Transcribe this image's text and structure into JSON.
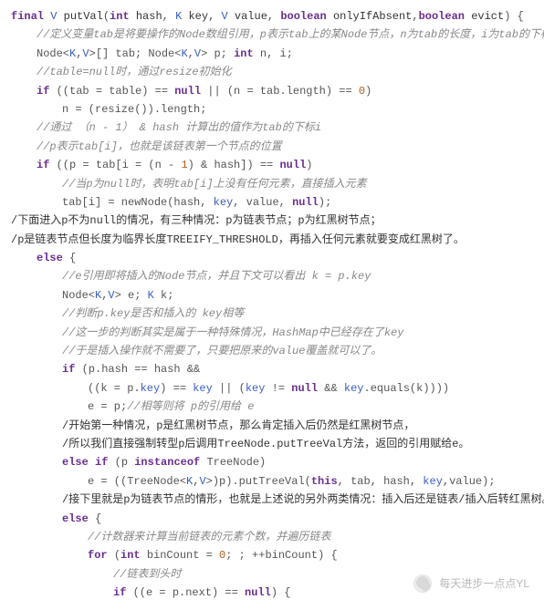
{
  "sig": {
    "final": "final",
    "retT": "V",
    "name": "putVal",
    "int": "int",
    "p1": "hash",
    "K": "K",
    "p2": "key",
    "V": "V",
    "p3": "value",
    "bool": "boolean",
    "p4": "onlyIfAbsent",
    "p5": "evict"
  },
  "c": {
    "l2": "//定义变量tab是将要操作的Node数组引用，p表示tab上的某Node节点，n为tab的长度，i为tab的下标。",
    "l4": "//table=null时，通过resize初始化",
    "l7": "//通过 （n - 1） & hash 计算出的值作为tab的下标i",
    "l8": "//p表示tab[i]，也就是该链表第一个节点的位置",
    "l10": "//当p为null时，表明tab[i]上没有任何元素，直接插入元素",
    "l15": "//e引用即将插入的Node节点，并且下文可以看出 k = p.key",
    "l17": "//判断p.key是否和插入的 key相等",
    "l18": "//这一步的判断其实是属于一种特殊情况，HashMap中已经存在了key",
    "l19": "//于是插入操作就不需要了，只要把原来的value覆盖就可以了。",
    "l22": "//相等则将 p的引用给 e",
    "l28": "//计数器来计算当前链表的元素个数，并遍历链表",
    "l30": "//链表到头时"
  },
  "d": {
    "l3a": "Node<",
    "l3b": ">[] tab; Node<",
    "l3c": "> p; ",
    "l3int": "int",
    "l3d": " n, i;",
    "l5a": "((tab = table) == ",
    "l5null": "null",
    "l5b": " || (n = tab.length) == ",
    "l5z": "0",
    "l5c": ")",
    "l6": "n = (resize()).length;",
    "l9a": "((p = tab[i = (n - ",
    "l9one": "1",
    "l9b": ") & hash]) == ",
    "l9c": ")",
    "l11a": "tab[i] = newNode(hash, ",
    "l11b": ", value, ",
    "l11c": ");",
    "l12": "/下面进入p不为null的情况，有三种情况：p为链表节点；p为红黑树节点；",
    "l13": "/p是链表节点但长度为临界长度TREEIFY_THRESHOLD，再插入任何元素就要变成红黑树了。",
    "l16a": "Node<",
    "l16b": "> e; ",
    "l16c": " k;",
    "l20": "(p.hash == hash &&",
    "l21a": "((k = p.",
    "l21b": ") == ",
    "l21c": " || (",
    "l21d": " != ",
    "l21e": " && ",
    "l21f": ".equals(k))))",
    "l22a": "e = p;",
    "l23": "/开始第一种情况，p是红黑树节点，那么肯定插入后仍然是红黑树节点，",
    "l24": "/所以我们直接强制转型p后调用TreeNode.putTreeVal方法，返回的引用赋给e。",
    "l25": "(p ",
    "l25io": "instanceof",
    "l25b": " TreeNode)",
    "l26a": "e = ((TreeNode<",
    "l26b": ">)p).putTreeVal(",
    "l26this": "this",
    "l26c": ", tab, hash, ",
    "l26d": ",value);",
    "l27": "/接下里就是p为链表节点的情形，也就是上述说的另外两类情况：插入后还是链表/插入后转红黑树。",
    "l29a": "(",
    "l29int": "int",
    "l29b": " binCount = ",
    "l29z": "0",
    "l29c": "; ; ++binCount) {",
    "l31a": "((e = p.next) == ",
    "l31b": ") {"
  },
  "kw": {
    "if": "if",
    "else": "else",
    "for": "for",
    "null": "null",
    "key": "key"
  },
  "kv": {
    "K": "K",
    "V": "V"
  },
  "wm": "每天进步一点点YL"
}
